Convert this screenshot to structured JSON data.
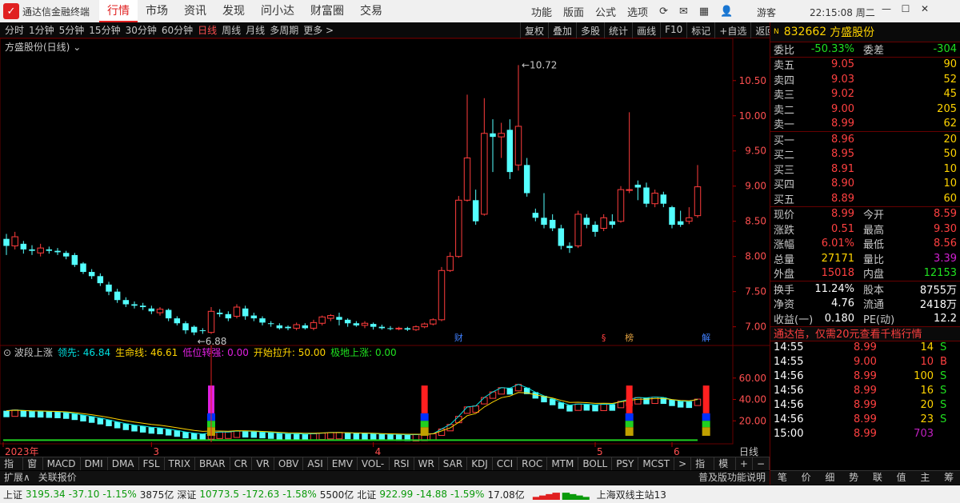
{
  "app": {
    "title": "通达信金融终端",
    "tabs": [
      "行情",
      "市场",
      "资讯",
      "发现",
      "问小达",
      "财富圈",
      "交易"
    ],
    "active_tab": "行情",
    "tools": [
      "功能",
      "版面",
      "公式",
      "选项"
    ],
    "guest": "游客",
    "clock": "22:15:08 周二"
  },
  "periods": [
    "分时",
    "1分钟",
    "5分钟",
    "15分钟",
    "30分钟",
    "60分钟",
    "日线",
    "周线",
    "月线",
    "多周期",
    "更多 >"
  ],
  "active_period": "日线",
  "right_buttons": [
    "复权",
    "叠加",
    "多股",
    "统计",
    "画线",
    "F10",
    "标记",
    "+自选",
    "返回"
  ],
  "chart_title": "方盛股份(日线)",
  "chart_data": {
    "type": "candlestick",
    "y_ticks": [
      10.5,
      10.0,
      9.5,
      9.0,
      8.5,
      8.0,
      7.5,
      7.0
    ],
    "ylim": [
      6.78,
      10.85
    ],
    "x_labels": [
      "2023年",
      "3",
      "4",
      "5",
      "6"
    ],
    "high_label": "10.72",
    "low_label": "6.88",
    "event_markers": [
      "财",
      "§",
      "榜",
      "解"
    ],
    "candles": [
      [
        8.25,
        8.15,
        8.32,
        8.02
      ],
      [
        8.15,
        8.28,
        8.35,
        8.1
      ],
      [
        8.18,
        8.1,
        8.22,
        8.04
      ],
      [
        8.1,
        8.08,
        8.16,
        8.02
      ],
      [
        8.05,
        8.12,
        8.18,
        8.0
      ],
      [
        8.1,
        8.08,
        8.14,
        8.04
      ],
      [
        8.08,
        8.06,
        8.12,
        8.02
      ],
      [
        8.05,
        8.0,
        8.08,
        7.96
      ],
      [
        8.02,
        7.88,
        8.05,
        7.85
      ],
      [
        7.9,
        7.78,
        7.92,
        7.75
      ],
      [
        7.78,
        7.72,
        7.82,
        7.68
      ],
      [
        7.72,
        7.62,
        7.76,
        7.58
      ],
      [
        7.6,
        7.5,
        7.64,
        7.45
      ],
      [
        7.5,
        7.38,
        7.54,
        7.34
      ],
      [
        7.38,
        7.32,
        7.42,
        7.28
      ],
      [
        7.32,
        7.3,
        7.36,
        7.26
      ],
      [
        7.3,
        7.28,
        7.34,
        7.24
      ],
      [
        7.26,
        7.22,
        7.3,
        7.18
      ],
      [
        7.2,
        7.25,
        7.28,
        7.16
      ],
      [
        7.24,
        7.12,
        7.26,
        7.08
      ],
      [
        7.12,
        7.05,
        7.15,
        7.02
      ],
      [
        7.05,
        6.95,
        7.08,
        6.9
      ],
      [
        7.0,
        6.92,
        7.02,
        6.88
      ],
      [
        6.95,
        6.94,
        6.98,
        6.9
      ],
      [
        6.92,
        7.22,
        7.28,
        6.9
      ],
      [
        7.2,
        7.18,
        7.25,
        7.14
      ],
      [
        7.18,
        7.12,
        7.22,
        7.08
      ],
      [
        7.15,
        7.28,
        7.32,
        7.12
      ],
      [
        7.26,
        7.15,
        7.3,
        7.1
      ],
      [
        7.16,
        7.12,
        7.2,
        7.08
      ],
      [
        7.12,
        7.06,
        7.15,
        7.02
      ],
      [
        7.05,
        7.04,
        7.08,
        7.0
      ],
      [
        7.02,
        6.98,
        7.05,
        6.96
      ],
      [
        7.0,
        6.98,
        7.02,
        6.95
      ],
      [
        6.98,
        7.03,
        7.06,
        6.95
      ],
      [
        7.02,
        6.98,
        7.05,
        6.96
      ],
      [
        6.98,
        7.06,
        7.1,
        6.95
      ],
      [
        7.05,
        7.14,
        7.16,
        7.02
      ],
      [
        7.12,
        7.16,
        7.18,
        7.08
      ],
      [
        7.14,
        7.1,
        7.2,
        7.02
      ],
      [
        7.1,
        7.05,
        7.12,
        7.0
      ],
      [
        7.05,
        7.02,
        7.08,
        7.0
      ],
      [
        7.02,
        7.05,
        7.08,
        6.98
      ],
      [
        7.04,
        7.0,
        7.06,
        6.96
      ],
      [
        7.0,
        6.98,
        7.03,
        6.96
      ],
      [
        6.98,
        6.97,
        7.01,
        6.95
      ],
      [
        6.97,
        6.98,
        7.0,
        6.95
      ],
      [
        6.98,
        6.96,
        7.0,
        6.94
      ],
      [
        6.96,
        7.0,
        7.02,
        6.94
      ],
      [
        7.0,
        7.04,
        7.06,
        6.98
      ],
      [
        7.04,
        7.1,
        7.12,
        7.02
      ],
      [
        7.1,
        7.8,
        7.85,
        7.08
      ],
      [
        7.8,
        8.0,
        8.06,
        7.78
      ],
      [
        8.0,
        8.8,
        8.86,
        7.98
      ],
      [
        8.8,
        9.4,
        10.3,
        8.78
      ],
      [
        8.8,
        8.5,
        8.95,
        8.45
      ],
      [
        8.6,
        9.75,
        10.25,
        8.58
      ],
      [
        9.75,
        9.7,
        9.95,
        9.2
      ],
      [
        9.7,
        9.75,
        9.9,
        9.4
      ],
      [
        9.8,
        9.2,
        9.95,
        9.1
      ],
      [
        9.3,
        9.85,
        10.72,
        9.22
      ],
      [
        9.3,
        8.9,
        9.4,
        8.85
      ],
      [
        8.62,
        8.55,
        8.68,
        8.5
      ],
      [
        8.55,
        8.45,
        8.9,
        8.4
      ],
      [
        8.52,
        8.4,
        8.6,
        8.36
      ],
      [
        8.4,
        8.15,
        8.45,
        8.1
      ],
      [
        8.15,
        8.12,
        8.2,
        8.05
      ],
      [
        8.15,
        8.6,
        8.65,
        8.12
      ],
      [
        8.55,
        8.45,
        8.6,
        8.4
      ],
      [
        8.45,
        8.35,
        8.5,
        8.28
      ],
      [
        8.4,
        8.55,
        8.6,
        8.36
      ],
      [
        8.5,
        8.45,
        8.6,
        8.4
      ],
      [
        8.5,
        8.95,
        9.0,
        8.48
      ],
      [
        8.95,
        8.95,
        10.05,
        8.9
      ],
      [
        9.02,
        8.98,
        9.08,
        8.8
      ],
      [
        8.98,
        8.75,
        9.05,
        8.7
      ],
      [
        8.75,
        8.9,
        8.95,
        8.7
      ],
      [
        8.88,
        8.75,
        8.92,
        8.7
      ],
      [
        8.7,
        8.45,
        8.72,
        8.4
      ],
      [
        8.5,
        8.45,
        8.65,
        8.42
      ],
      [
        8.5,
        8.55,
        8.7,
        8.46
      ],
      [
        8.58,
        8.99,
        9.3,
        8.55
      ]
    ]
  },
  "indicator": {
    "name": "波段上涨",
    "items": [
      {
        "label": "领先: 46.84",
        "color": "#00e0e0"
      },
      {
        "label": "生命线: 46.61",
        "color": "#ffd400"
      },
      {
        "label": "低位转强: 0.00",
        "color": "#e020e0"
      },
      {
        "label": "开始拉升: 50.00",
        "color": "#ffd400"
      },
      {
        "label": "极地上涨: 0.00",
        "color": "#20e020"
      }
    ],
    "y_ticks": [
      60.0,
      40.0,
      20.0
    ],
    "period_label": "日线"
  },
  "bottom_tabs": [
    "指标A",
    "窗口",
    "MACD",
    "DMI",
    "DMA",
    "FSL",
    "TRIX",
    "BRAR",
    "CR",
    "VR",
    "OBV",
    "ASI",
    "EMV",
    "VOL-TDX",
    "RSI",
    "WR",
    "SAR",
    "KDJ",
    "CCI",
    "ROC",
    "MTM",
    "BOLL",
    "PSY",
    "MCST",
    ">",
    "指标B",
    "模 板",
    "+",
    "−"
  ],
  "expand_bar": [
    "扩展∧",
    "关联报价",
    "普及版功能说明"
  ],
  "quote": {
    "code": "832662",
    "name": "方盛股份",
    "weibi": "-50.33%",
    "weicha": "-304",
    "asks": [
      {
        "label": "卖五",
        "price": "9.05",
        "vol": "90"
      },
      {
        "label": "卖四",
        "price": "9.03",
        "vol": "52"
      },
      {
        "label": "卖三",
        "price": "9.02",
        "vol": "45"
      },
      {
        "label": "卖二",
        "price": "9.00",
        "vol": "205"
      },
      {
        "label": "卖一",
        "price": "8.99",
        "vol": "62"
      }
    ],
    "bids": [
      {
        "label": "买一",
        "price": "8.96",
        "vol": "20"
      },
      {
        "label": "买二",
        "price": "8.95",
        "vol": "50"
      },
      {
        "label": "买三",
        "price": "8.91",
        "vol": "10"
      },
      {
        "label": "买四",
        "price": "8.90",
        "vol": "10"
      },
      {
        "label": "买五",
        "price": "8.89",
        "vol": "60"
      }
    ],
    "stats": [
      {
        "l1": "现价",
        "v1": "8.99",
        "l2": "今开",
        "v2": "8.59"
      },
      {
        "l1": "涨跌",
        "v1": "0.51",
        "l2": "最高",
        "v2": "9.30"
      },
      {
        "l1": "涨幅",
        "v1": "6.01%",
        "l2": "最低",
        "v2": "8.56"
      },
      {
        "l1": "总量",
        "v1": "27171",
        "l2": "量比",
        "v2": "3.39"
      },
      {
        "l1": "外盘",
        "v1": "15018",
        "l2": "内盘",
        "v2": "12153"
      }
    ],
    "stats2": [
      {
        "l1": "换手",
        "v1": "11.24%",
        "l2": "股本",
        "v2": "8755万"
      },
      {
        "l1": "净资",
        "v1": "4.76",
        "l2": "流通",
        "v2": "2418万"
      },
      {
        "l1": "收益(一)",
        "v1": "0.180",
        "l2": "PE(动)",
        "v2": "12.2"
      }
    ],
    "ad": "通达信，仅需20元查看千档行情",
    "ticks": [
      {
        "time": "14:55",
        "price": "8.99",
        "vol": "14",
        "side": "S"
      },
      {
        "time": "14:55",
        "price": "9.00",
        "vol": "10",
        "side": "B"
      },
      {
        "time": "14:56",
        "price": "8.99",
        "vol": "100",
        "side": "S"
      },
      {
        "time": "14:56",
        "price": "8.99",
        "vol": "16",
        "side": "S"
      },
      {
        "time": "14:56",
        "price": "8.99",
        "vol": "20",
        "side": "S"
      },
      {
        "time": "14:56",
        "price": "8.99",
        "vol": "23",
        "side": "S"
      },
      {
        "time": "15:00",
        "price": "8.99",
        "vol": "703",
        "side": ""
      }
    ],
    "bottom_tabs": [
      "笔",
      "价",
      "细",
      "势",
      "联",
      "值",
      "主",
      "筹"
    ]
  },
  "status": {
    "sh_label": "上证",
    "sh_val": "3195.34",
    "sh_chg": "-37.10",
    "sh_pct": "-1.15%",
    "sh_amt": "3875亿",
    "sz_label": "深证",
    "sz_val": "10773.5",
    "sz_chg": "-172.63",
    "sz_pct": "-1.58%",
    "sz_amt": "5500亿",
    "bz_label": "北证",
    "bz_val": "922.99",
    "bz_chg": "-14.88",
    "bz_pct": "-1.59%",
    "bz_amt": "17.08亿",
    "server": "上海双线主站13"
  },
  "colors": {
    "up": "#ff3c3c",
    "down": "#54ffff",
    "ma1": "#00e0e0",
    "ma2": "#ffd400"
  }
}
